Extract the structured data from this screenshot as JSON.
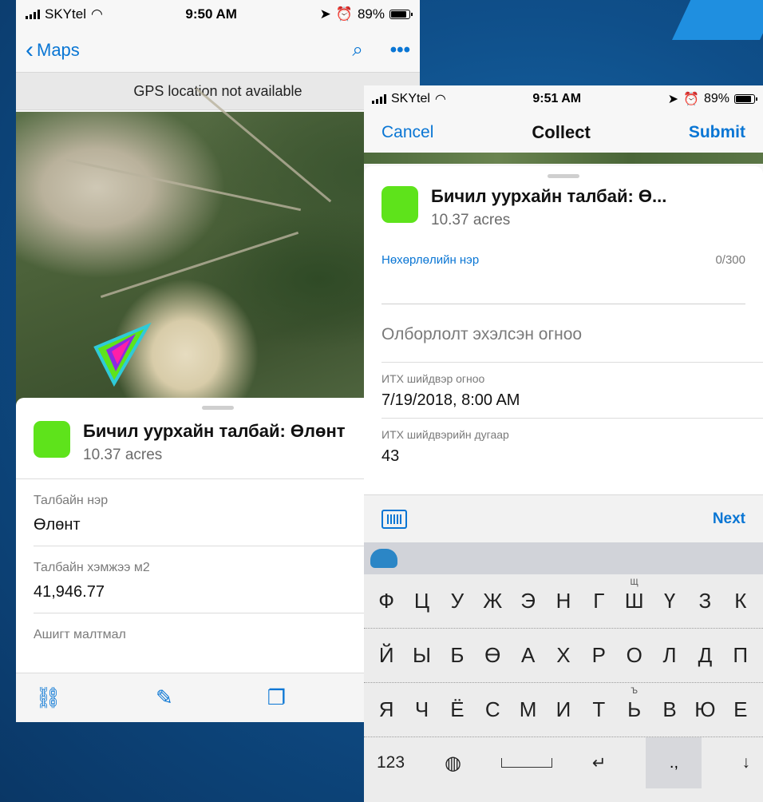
{
  "phone1": {
    "status": {
      "carrier": "SKYtel",
      "time": "9:50 AM",
      "battery": "89%"
    },
    "nav": {
      "back_label": "Maps",
      "search_icon": "search-icon",
      "more_icon": "more-icon"
    },
    "banner": "GPS location not available",
    "feature": {
      "title": "Бичил уурхайн талбай: Өлөнт",
      "subtitle": "10.37 acres",
      "color": "#5ee31b",
      "fields": [
        {
          "label": "Талбайн нэр",
          "value": "Өлөнт"
        },
        {
          "label": "Талбайн хэмжээ м2",
          "value": "41,946.77"
        },
        {
          "label": "Ашигт малтмал",
          "value": ""
        }
      ]
    },
    "toolbar": {
      "link_icon": "link-icon",
      "edit_icon": "pencil-icon",
      "copy_icon": "copy-icon"
    }
  },
  "phone2": {
    "status": {
      "carrier": "SKYtel",
      "time": "9:51 AM",
      "battery": "89%"
    },
    "nav": {
      "cancel": "Cancel",
      "title": "Collect",
      "submit": "Submit"
    },
    "feature": {
      "title": "Бичил уурхайн талбай: Ө...",
      "subtitle": "10.37 acres",
      "color": "#5ee31b"
    },
    "form": {
      "partner_label": "Нөхөрлөлийн нэр",
      "partner_count": "0/300",
      "start_placeholder": "Олборлолт эхэлсэн огноо",
      "decision_date_label": "ИТХ шийдвэр огноо",
      "decision_date_value": "7/19/2018, 8:00 AM",
      "decision_number_label": "ИТХ шийдвэрийн дугаар",
      "decision_number_value": "43"
    },
    "accessory": {
      "next": "Next"
    },
    "keyboard": {
      "row1": [
        "Ф",
        "Ц",
        "У",
        "Ж",
        "Э",
        "Н",
        "Г",
        "Ш",
        "Ү",
        "З",
        "К"
      ],
      "row1_hint": "Щ",
      "row2": [
        "Й",
        "Ы",
        "Б",
        "Ө",
        "А",
        "Х",
        "Р",
        "О",
        "Л",
        "Д",
        "П"
      ],
      "row3": [
        "Я",
        "Ч",
        "Ё",
        "С",
        "М",
        "И",
        "Т",
        "Ь",
        "В",
        "Ю",
        "Е"
      ],
      "row3_hint": "Ъ",
      "numbers": "123",
      "punct": ".,"
    }
  }
}
